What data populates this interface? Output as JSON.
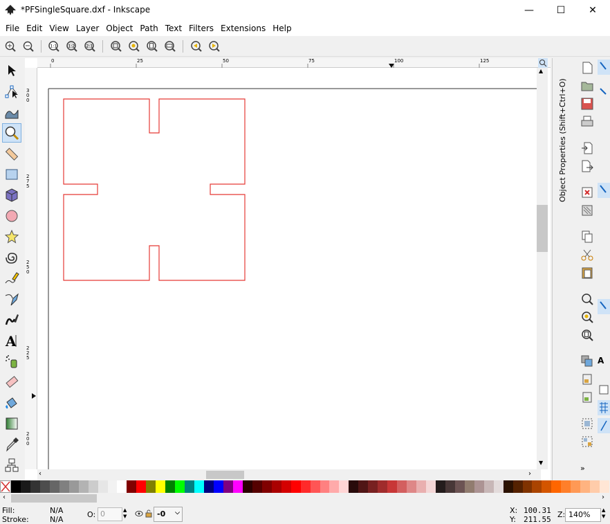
{
  "window": {
    "title": "*PFSingleSquare.dxf - Inkscape",
    "minimize": "—",
    "maximize": "☐",
    "close": "✕"
  },
  "menu": [
    {
      "label": "File"
    },
    {
      "label": "Edit"
    },
    {
      "label": "View"
    },
    {
      "label": "Layer"
    },
    {
      "label": "Object"
    },
    {
      "label": "Path"
    },
    {
      "label": "Text"
    },
    {
      "label": "Filters"
    },
    {
      "label": "Extensions"
    },
    {
      "label": "Help"
    }
  ],
  "ruler": {
    "h_ticks": [
      "0",
      "25",
      "50",
      "75",
      "100",
      "125"
    ],
    "v_ticks": [
      "300",
      "275",
      "250",
      "225",
      "200"
    ]
  },
  "dock": {
    "panel_title": "Object Properties (Shift+Ctrl+O)"
  },
  "palette": {
    "colors": [
      "#000000",
      "#1a1a1a",
      "#333333",
      "#4d4d4d",
      "#666666",
      "#808080",
      "#999999",
      "#b3b3b3",
      "#cccccc",
      "#e6e6e6",
      "#f2f2f2",
      "#ffffff",
      "#800000",
      "#ff0000",
      "#808000",
      "#ffff00",
      "#008000",
      "#00ff00",
      "#008080",
      "#00ffff",
      "#000080",
      "#0000ff",
      "#800080",
      "#ff00ff",
      "#2b0000",
      "#550000",
      "#800000",
      "#aa0000",
      "#d40000",
      "#ff0000",
      "#ff2a2a",
      "#ff5555",
      "#ff8080",
      "#ffaaaa",
      "#ffd5d5",
      "#280b0b",
      "#501616",
      "#782121",
      "#a02c2c",
      "#c83737",
      "#d35f5f",
      "#de8787",
      "#e9afaf",
      "#f4d7d7",
      "#241c1c",
      "#483737",
      "#6c5353",
      "#917c6f",
      "#ac9393",
      "#c8b7b7",
      "#e3dbdb",
      "#2b1100",
      "#552200",
      "#803300",
      "#aa4400",
      "#d45500",
      "#ff6600",
      "#ff7f2a",
      "#ff9955",
      "#ffb380",
      "#ffccaa",
      "#ffe6d5"
    ]
  },
  "status": {
    "fill_label": "Fill:",
    "fill_value": "N/A",
    "stroke_label": "Stroke:",
    "stroke_value": "N/A",
    "opacity_label": "O:",
    "opacity_value": "0",
    "layer_value": "-0",
    "x_label": "X:",
    "x_value": "100.31",
    "y_label": "Y:",
    "y_value": "211.55",
    "zoom_label": "Z:",
    "zoom_value": "140%"
  },
  "colors": {
    "shape_stroke": "#e53935",
    "active_tool_bg": "#cfe3f7"
  }
}
